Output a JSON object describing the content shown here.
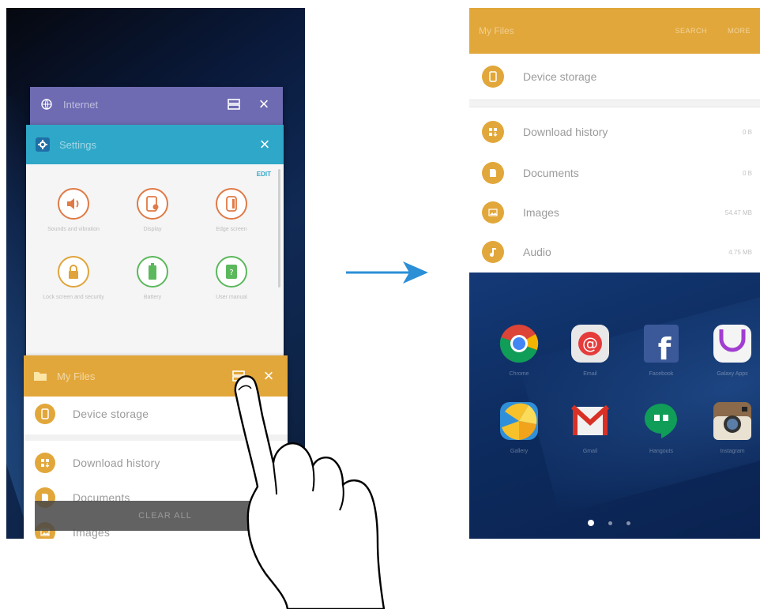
{
  "left_screen": {
    "internet_card": {
      "title": "Internet",
      "icon": "globe-icon"
    },
    "settings_card": {
      "title": "Settings",
      "edit_label": "EDIT",
      "items": [
        {
          "label": "Sounds and vibration",
          "icon": "sound-icon",
          "color": "#e07a46"
        },
        {
          "label": "Display",
          "icon": "display-icon",
          "color": "#e07a46"
        },
        {
          "label": "Edge screen",
          "icon": "edge-screen-icon",
          "color": "#e07a46"
        },
        {
          "label": "Lock screen and security",
          "icon": "lock-icon",
          "color": "#e0a43a"
        },
        {
          "label": "Battery",
          "icon": "battery-icon",
          "color": "#5cb85c"
        },
        {
          "label": "User manual",
          "icon": "user-manual-icon",
          "color": "#5cb85c"
        }
      ]
    },
    "files_card": {
      "title": "My Files",
      "rows": [
        {
          "label": "Device storage",
          "icon": "phone-icon"
        },
        {
          "label": "Download history",
          "icon": "download-icon"
        },
        {
          "label": "Documents",
          "icon": "document-icon"
        },
        {
          "label": "Images",
          "icon": "image-icon"
        }
      ]
    },
    "clear_all_label": "CLEAR ALL"
  },
  "right_screen": {
    "header": {
      "title": "My Files",
      "actions": [
        "SEARCH",
        "MORE"
      ]
    },
    "storage": {
      "label": "Device storage",
      "icon": "phone-icon"
    },
    "categories": [
      {
        "label": "Download history",
        "size": "0 B",
        "icon": "download-icon"
      },
      {
        "label": "Documents",
        "size": "0 B",
        "icon": "document-icon"
      },
      {
        "label": "Images",
        "size": "54.47 MB",
        "icon": "image-icon"
      },
      {
        "label": "Audio",
        "size": "4.75 MB",
        "icon": "music-icon"
      }
    ],
    "apps": [
      {
        "label": "Chrome",
        "icon": "chrome-icon"
      },
      {
        "label": "Email",
        "icon": "email-icon"
      },
      {
        "label": "Facebook",
        "icon": "facebook-icon"
      },
      {
        "label": "Galaxy Apps",
        "icon": "galaxy-apps-icon"
      },
      {
        "label": "Gallery",
        "icon": "gallery-icon"
      },
      {
        "label": "Gmail",
        "icon": "gmail-icon"
      },
      {
        "label": "Hangouts",
        "icon": "hangouts-icon"
      },
      {
        "label": "Instagram",
        "icon": "instagram-icon"
      }
    ],
    "page_count": 3,
    "active_page": 1
  },
  "colors": {
    "my_files_accent": "#e2a73a",
    "settings_accent": "#2fa7c8",
    "internet_accent": "#6e6bb3",
    "arrow": "#2b8fd6"
  }
}
